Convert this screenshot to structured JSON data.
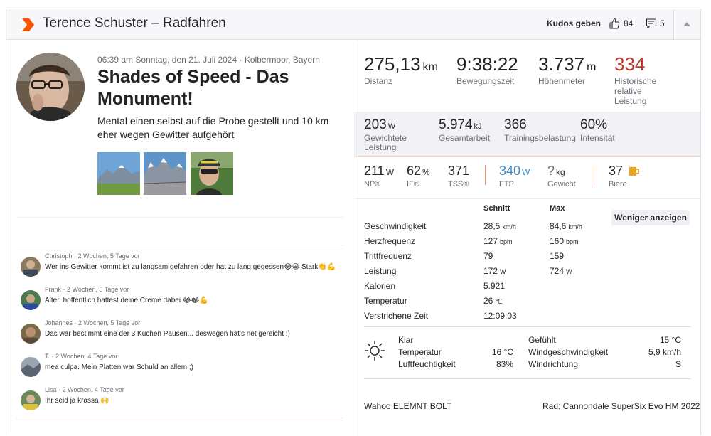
{
  "header": {
    "title": "Terence Schuster – Radfahren",
    "kudos_label": "Kudos geben",
    "kudos_count": "84",
    "comment_count": "5"
  },
  "activity": {
    "meta": "06:39 am Sonntag, den 21. Juli 2024 · Kolbermoor, Bayern",
    "title": "Shades of Speed - Das Monument!",
    "description": "Mental einen selbst auf die Probe gestellt und 10 km eher wegen Gewitter aufgehört"
  },
  "comments": [
    {
      "name": "Christoph",
      "time": "2 Wochen, 5 Tage vor",
      "text": "Wer ins Gewitter kommt ist zu langsam gefahren oder hat zu lang gegessen😂😁 Stark👏💪"
    },
    {
      "name": "Frank",
      "time": "2 Wochen, 5 Tage vor",
      "text": "Alter, hoffentlich hattest deine Creme dabei 😂😂💪"
    },
    {
      "name": "Johannes",
      "time": "2 Wochen, 5 Tage vor",
      "text": "Das war bestimmt eine der 3 Kuchen Pausen... deswegen hat's net gereicht ;)"
    },
    {
      "name": "T.",
      "time": "2 Wochen, 4 Tage vor",
      "text": "mea culpa. Mein Platten war Schuld an allem ;)"
    },
    {
      "name": "Lisa",
      "time": "2 Wochen, 4 Tage vor",
      "text": "Ihr seid ja krassa 🙌"
    }
  ],
  "big_stats": [
    {
      "value": "275,13",
      "unit": "km",
      "label": "Distanz"
    },
    {
      "value": "9:38:22",
      "unit": "",
      "label": "Bewegungszeit"
    },
    {
      "value": "3.737",
      "unit": "m",
      "label": "Höhenmeter"
    },
    {
      "value": "334",
      "unit": "",
      "label": "Historische relative Leistung"
    }
  ],
  "mid_stats": [
    {
      "value": "203",
      "unit": "W",
      "label": "Gewichtete Leistung"
    },
    {
      "value": "5.974",
      "unit": "kJ",
      "label": "Gesamtarbeit"
    },
    {
      "value": "366",
      "unit": "",
      "label": "Trainingsbelastung"
    },
    {
      "value": "60%",
      "unit": "",
      "label": "Intensität"
    }
  ],
  "small_stats": [
    {
      "value": "211",
      "unit": "W",
      "label": "NP®"
    },
    {
      "value": "62",
      "unit": "%",
      "label": "IF®"
    },
    {
      "value": "371",
      "unit": "",
      "label": "TSS®"
    },
    {
      "value": "340",
      "unit": "W",
      "label": "FTP"
    },
    {
      "value": "?",
      "unit": "kg",
      "label": "Gewicht"
    },
    {
      "value": "37",
      "unit": "",
      "label": "Biere"
    }
  ],
  "table": {
    "col_avg": "Schnitt",
    "col_max": "Max",
    "less_label": "Weniger anzeigen",
    "rows": [
      {
        "k": "Geschwindigkeit",
        "a": "28,5",
        "au": "km/h",
        "m": "84,6",
        "mu": "km/h"
      },
      {
        "k": "Herzfrequenz",
        "a": "127",
        "au": "bpm",
        "m": "160",
        "mu": "bpm"
      },
      {
        "k": "Trittfrequenz",
        "a": "79",
        "au": "",
        "m": "159",
        "mu": ""
      },
      {
        "k": "Leistung",
        "a": "172",
        "au": "W",
        "m": "724",
        "mu": "W"
      },
      {
        "k": "Kalorien",
        "a": "5.921",
        "au": "",
        "m": "",
        "mu": ""
      },
      {
        "k": "Temperatur",
        "a": "26",
        "au": "℃",
        "m": "",
        "mu": ""
      },
      {
        "k": "Verstrichene Zeit",
        "a": "12:09:03",
        "au": "",
        "m": "",
        "mu": ""
      }
    ]
  },
  "weather": {
    "condition": "Klar",
    "temp_label": "Temperatur",
    "temp_value": "16 °C",
    "humidity_label": "Luftfeuchtigkeit",
    "humidity_value": "83%",
    "feels_label": "Gefühlt",
    "feels_value": "15 °C",
    "wind_label": "Windgeschwindigkeit",
    "wind_value": "5,9 km/h",
    "dir_label": "Windrichtung",
    "dir_value": "S"
  },
  "device": "Wahoo ELEMNT BOLT",
  "bike": "Rad: Cannondale SuperSix Evo HM 2022",
  "colors": {
    "accent": "#fc5200",
    "red_stat": "#c0392b",
    "ftp_blue": "#3b8bc9"
  }
}
